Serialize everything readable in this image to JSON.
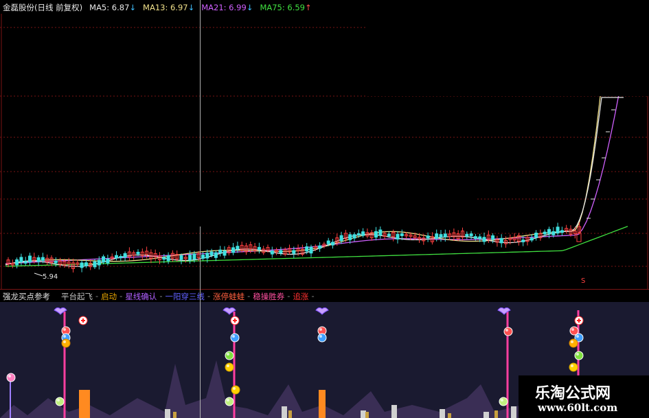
{
  "header": {
    "title": "金磊股份(日线 前复权)",
    "ma5_label": "MA5: 6.87",
    "ma13_label": "MA13: 6.97",
    "ma21_label": "MA21: 6.99",
    "ma75_label": "MA75: 6.59",
    "down_arrow": "↓",
    "up_arrow": "↑"
  },
  "main": {
    "low_price_label": "5.94",
    "marker_label": "S"
  },
  "indicator": {
    "name": "强龙买点参考",
    "signals": [
      {
        "label": "平台起飞",
        "color": "#c0c0c0"
      },
      {
        "label": "启动",
        "color": "#e0a000"
      },
      {
        "label": "星线确认",
        "color": "#b060ff"
      },
      {
        "label": "一阳穿三线",
        "color": "#6060ff"
      },
      {
        "label": "涨停蛙蛙",
        "color": "#ff6040"
      },
      {
        "label": "稳操胜券",
        "color": "#ff50a0"
      },
      {
        "label": "追涨",
        "color": "#ff3030"
      }
    ],
    "dash": "-"
  },
  "watermark": {
    "line1": "乐淘公式网",
    "line2": "www.60lt.com"
  },
  "colors": {
    "ma5": "#e8e8e8",
    "ma13": "#f0e08a",
    "ma21": "#d060ff",
    "ma75": "#40e040",
    "candle_up": "#ff4040",
    "candle_down": "#40e0e0",
    "grid": "#7a1414"
  }
}
